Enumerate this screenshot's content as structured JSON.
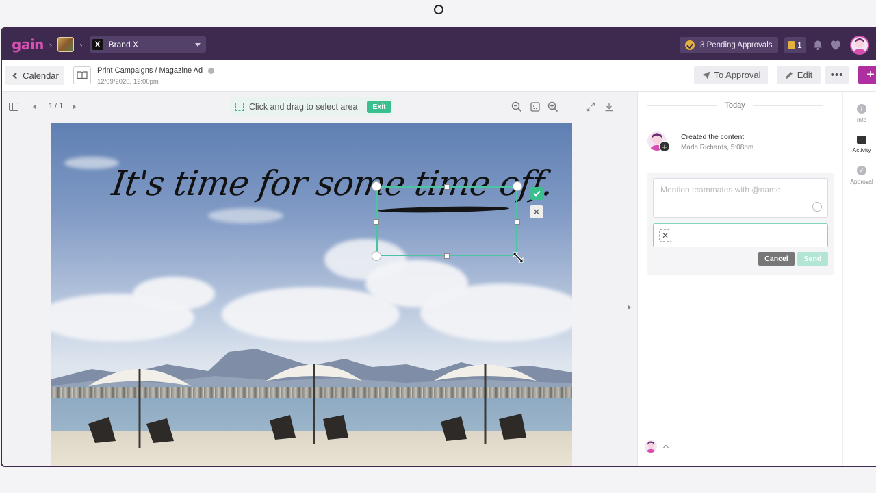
{
  "app": {
    "logo": "gain",
    "brand_name": "Brand X",
    "brand_logo_glyph": "X",
    "pending_approvals": "3 Pending Approvals",
    "notifications_count": "1",
    "accent": "#d64fb0",
    "header_bg": "#3d2a4e",
    "success": "#3bbf8f"
  },
  "subheader": {
    "back_label": "Calendar",
    "title": "Print Campaigns / Magazine Ad",
    "date": "12/09/2020, 12:00pm",
    "to_approval_label": "To Approval",
    "edit_label": "Edit",
    "more_label": "•••",
    "add_label": "+"
  },
  "viewer": {
    "page_indicator": "1 / 1",
    "select_hint": "Click and drag to select area",
    "exit_label": "Exit",
    "headline": "It's time for some time off."
  },
  "activity": {
    "day_label": "Today",
    "event_title": "Created the content",
    "event_meta": "Marla Richards, 5:08pm",
    "comment_placeholder": "Mention teammates with @name",
    "cancel_label": "Cancel",
    "send_label": "Send"
  },
  "side_tabs": [
    {
      "label": "Info",
      "icon": "info-icon"
    },
    {
      "label": "Activity",
      "icon": "activity-icon"
    },
    {
      "label": "Approval",
      "icon": "approval-icon"
    }
  ]
}
